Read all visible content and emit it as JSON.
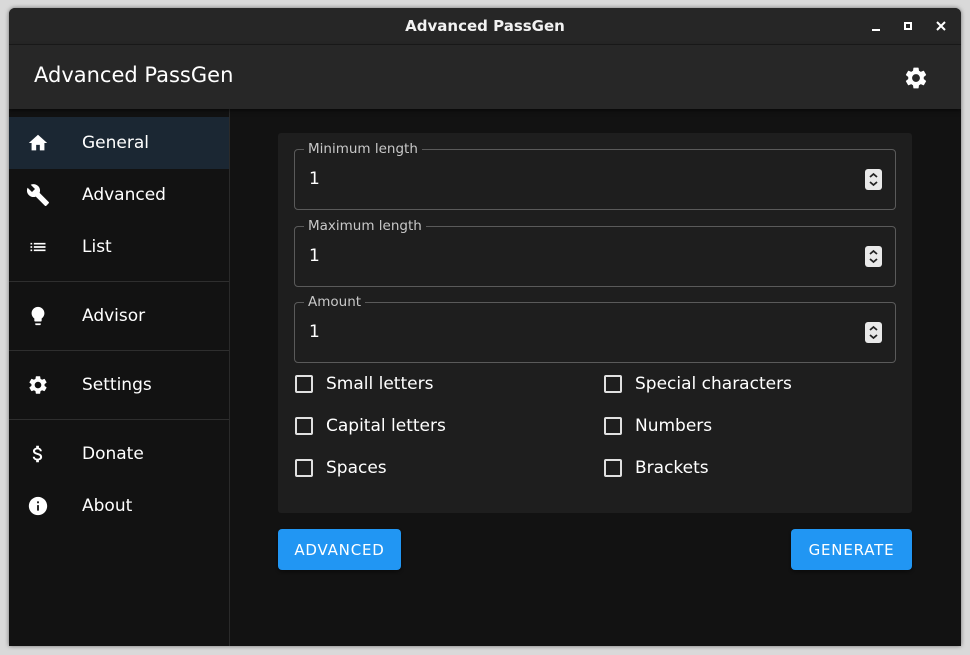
{
  "window": {
    "title": "Advanced PassGen"
  },
  "appbar": {
    "title": "Advanced PassGen",
    "settings_icon": "gear-icon"
  },
  "nav": {
    "items": [
      {
        "label": "General",
        "icon": "home-icon",
        "active": true
      },
      {
        "label": "Advanced",
        "icon": "wrench-icon",
        "active": false
      },
      {
        "label": "List",
        "icon": "list-icon",
        "active": false
      },
      {
        "label": "Advisor",
        "icon": "lightbulb-icon",
        "active": false
      },
      {
        "label": "Settings",
        "icon": "gear-icon",
        "active": false
      },
      {
        "label": "Donate",
        "icon": "dollar-icon",
        "active": false
      },
      {
        "label": "About",
        "icon": "info-icon",
        "active": false
      }
    ]
  },
  "form": {
    "min_length": {
      "label": "Minimum length",
      "value": "1"
    },
    "max_length": {
      "label": "Maximum length",
      "value": "1"
    },
    "amount": {
      "label": "Amount",
      "value": "1"
    },
    "checkboxes": {
      "small_letters": {
        "label": "Small letters",
        "checked": false
      },
      "capital_letters": {
        "label": "Capital letters",
        "checked": false
      },
      "spaces": {
        "label": "Spaces",
        "checked": false
      },
      "special_characters": {
        "label": "Special characters",
        "checked": false
      },
      "numbers": {
        "label": "Numbers",
        "checked": false
      },
      "brackets": {
        "label": "Brackets",
        "checked": false
      }
    }
  },
  "buttons": {
    "advanced": "ADVANCED",
    "generate": "GENERATE"
  },
  "colors": {
    "accent": "#2196f3",
    "background": "#121212",
    "appbar": "#272727",
    "active_nav": "#1b2733",
    "card": "#1e1e1e"
  }
}
